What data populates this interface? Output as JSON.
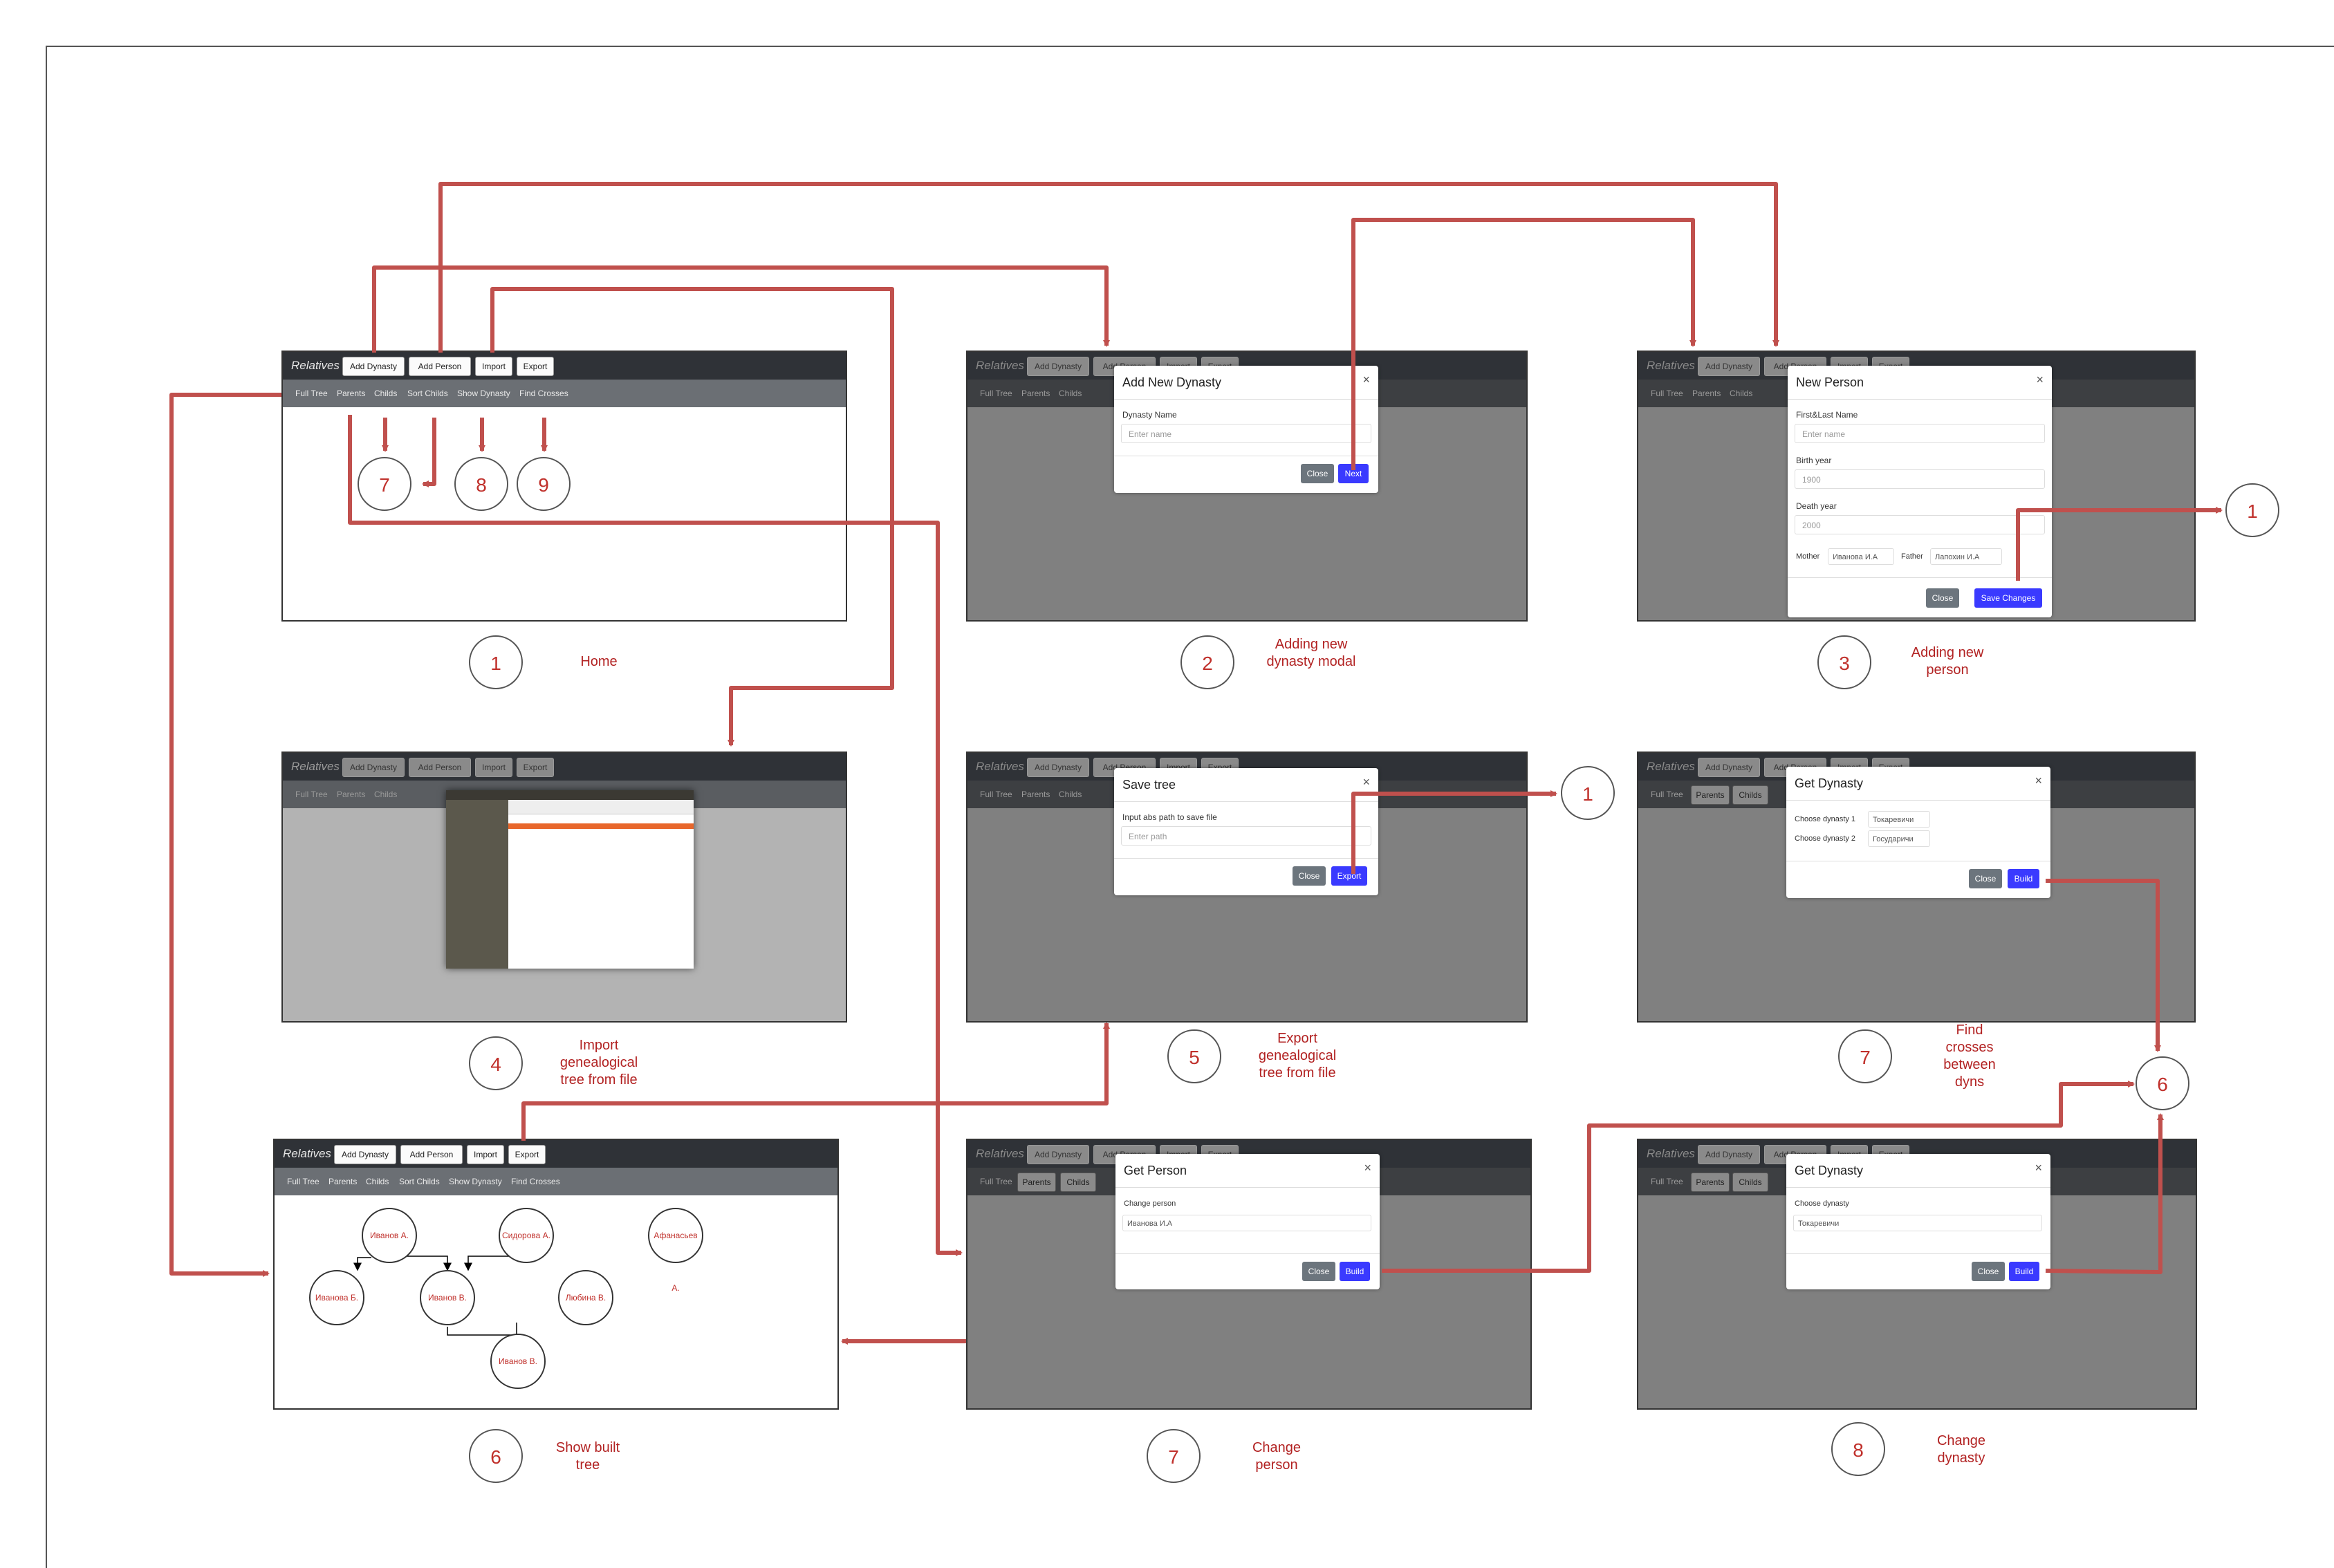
{
  "app": {
    "brand": "Relatives",
    "buttons": {
      "add_dynasty": "Add Dynasty",
      "add_person": "Add Person",
      "import": "Import",
      "export": "Export"
    },
    "links": {
      "full_tree": "Full Tree",
      "parents": "Parents",
      "childs": "Childs",
      "sort_childs": "Sort Childs",
      "show_dynasty": "Show Dynasty",
      "find_crosses": "Find Crosses"
    }
  },
  "screens": {
    "home": {
      "number": "1",
      "caption": "Home"
    },
    "add_dynasty": {
      "number": "2",
      "caption": "Adding new dynasty modal"
    },
    "add_person": {
      "number": "3",
      "caption": "Adding new person"
    },
    "import": {
      "number": "4",
      "caption": "Import genealogical tree from file"
    },
    "export": {
      "number": "5",
      "caption": "Export genealogical tree from file"
    },
    "find_crosses": {
      "number": "7",
      "caption": "Find crosses between dyns"
    },
    "show_tree": {
      "number": "6",
      "caption": "Show built tree"
    },
    "change_person": {
      "number": "7",
      "caption": "Change person"
    },
    "change_dynasty": {
      "number": "8",
      "caption": "Change dynasty"
    }
  },
  "home_markers": [
    "7",
    "8",
    "9"
  ],
  "side_markers": {
    "right_of_person": "1",
    "right_of_export": "1",
    "right_side": "6"
  },
  "modals": {
    "dynasty": {
      "title": "Add New Dynasty",
      "label": "Dynasty Name",
      "placeholder": "Enter name",
      "close": "Close",
      "next": "Next"
    },
    "person": {
      "title": "New Person",
      "name_label": "First&Last Name",
      "name_placeholder": "Enter name",
      "birth_label": "Birth year",
      "birth_value": "1900",
      "death_label": "Death year",
      "death_value": "2000",
      "mother_label": "Mother",
      "mother_value": "Иванова И.А",
      "father_label": "Father",
      "father_value": "Лапохин И.А",
      "close": "Close",
      "save": "Save Changes"
    },
    "save_tree": {
      "title": "Save tree",
      "label": "Input abs path to save file",
      "placeholder": "Enter path",
      "close": "Close",
      "export": "Export"
    },
    "get_dynasty_cross": {
      "title": "Get Dynasty",
      "label1": "Choose dynasty 1",
      "value1": "Токаревичи",
      "label2": "Choose dynasty 2",
      "value2": "Государичи",
      "close": "Close",
      "build": "Build"
    },
    "get_person": {
      "title": "Get Person",
      "label": "Change person",
      "value": "Иванова И.А",
      "close": "Close",
      "build": "Build"
    },
    "get_dynasty": {
      "title": "Get Dynasty",
      "label": "Choose dynasty",
      "value": "Токаревичи",
      "close": "Close",
      "build": "Build"
    }
  },
  "tree_nodes": [
    {
      "name": "Иванов А."
    },
    {
      "name": "Сидорова А."
    },
    {
      "name": "Афанасьев А."
    },
    {
      "name": "Иванова Б."
    },
    {
      "name": "Иванов В."
    },
    {
      "name": "Любина В."
    },
    {
      "name": "Иванов В."
    }
  ],
  "colors": {
    "arrow": "#c0504d",
    "caption": "#b22222",
    "navbar": "#2f3237",
    "subnav": "#6b6f74",
    "overlay": "#808080",
    "primary_button": "#3a3aff"
  }
}
